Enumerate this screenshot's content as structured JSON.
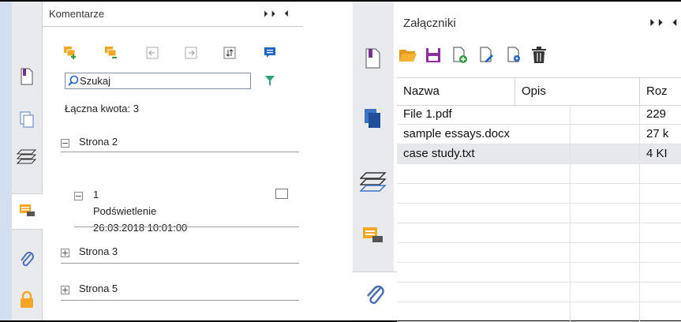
{
  "comments_panel": {
    "title": "Komentarze",
    "controls": "⏵⏵ ⏴",
    "search": {
      "value": "Szukaj"
    },
    "total": "Łączna kwota: 3",
    "tree": [
      {
        "label": "Strona 2",
        "expanded": true,
        "children": [
          {
            "number": "1",
            "type": "Podświetlenie",
            "date": "26.03.2018 10:01:00"
          }
        ]
      },
      {
        "label": "Strona 3",
        "expanded": false
      },
      {
        "label": "Strona 5",
        "expanded": false
      }
    ],
    "toolbar_icons": [
      "import-comments-icon",
      "export-comments-icon",
      "prev-comment-icon",
      "next-comment-icon",
      "sort-icon",
      "comment-icon"
    ]
  },
  "attachments_panel": {
    "title": "Załączniki",
    "controls": "⏵⏵ ⏴",
    "columns": [
      "Nazwa",
      "Opis",
      "Roz"
    ],
    "rows": [
      {
        "name": "File 1.pdf",
        "desc": "",
        "size": "229"
      },
      {
        "name": "sample essays.docx",
        "desc": "",
        "size": "27 k"
      },
      {
        "name": "case study.txt",
        "desc": "",
        "size": "4 KI"
      }
    ],
    "selected_row": 2,
    "toolbar_icons": [
      "open-folder-icon",
      "save-icon",
      "add-file-icon",
      "edit-file-icon",
      "file-settings-icon",
      "delete-icon"
    ]
  },
  "colors": {
    "accent_orange": "#f5a623",
    "accent_purple": "#7b2f8e",
    "accent_blue": "#1f66c7",
    "accent_green": "#2e9e7c"
  }
}
